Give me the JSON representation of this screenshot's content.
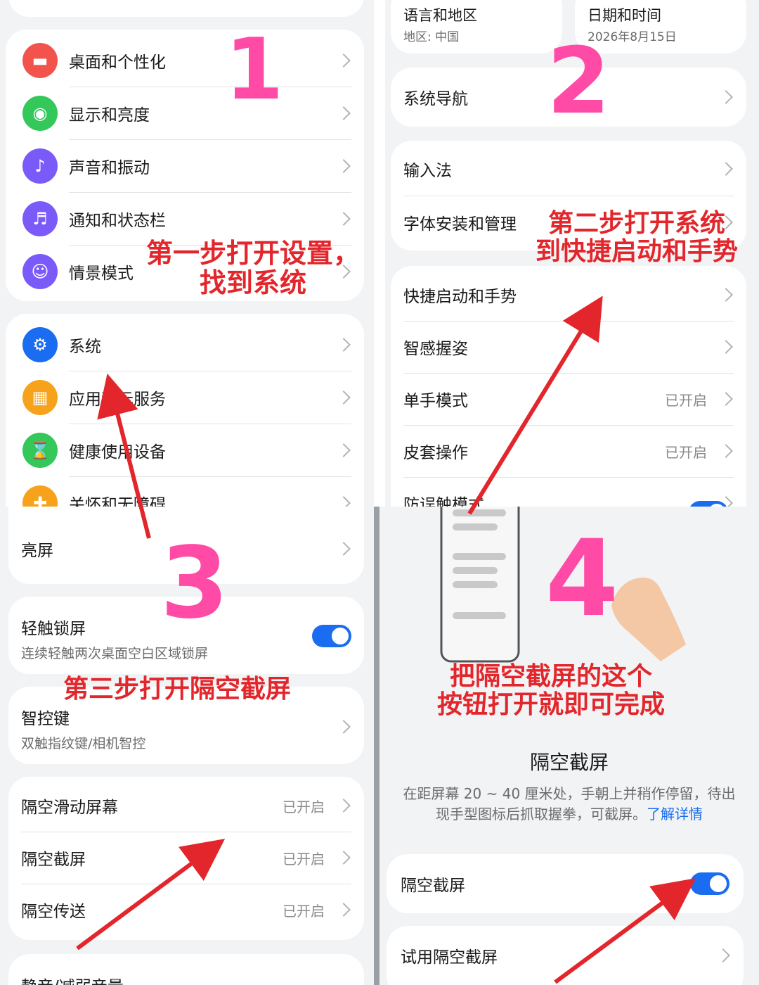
{
  "panel1": {
    "card_a_items": [
      {
        "label": "桌面和个性化",
        "icon": "paint-roller-icon",
        "icon_bg": "#f2544d"
      },
      {
        "label": "显示和亮度",
        "icon": "eye-icon",
        "icon_bg": "#34c759"
      },
      {
        "label": "声音和振动",
        "icon": "speaker-icon",
        "icon_bg": "#7a5af8"
      },
      {
        "label": "通知和状态栏",
        "icon": "bell-icon",
        "icon_bg": "#7a5af8"
      },
      {
        "label": "情景模式",
        "icon": "person-circle-icon",
        "icon_bg": "#7a5af8"
      }
    ],
    "card_b_items": [
      {
        "label": "系统",
        "icon": "gear-icon",
        "icon_bg": "#1a6cf0"
      },
      {
        "label": "应用和元服务",
        "icon": "apps-grid-icon",
        "icon_bg": "#f7a21b"
      },
      {
        "label": "健康使用设备",
        "icon": "hourglass-icon",
        "icon_bg": "#34c759"
      },
      {
        "label": "关怀和无障碍",
        "icon": "accessibility-icon",
        "icon_bg": "#f7a21b"
      }
    ],
    "annotation": "第一步打开设置，\n找到系统",
    "step_number": "1"
  },
  "panel2": {
    "tiles": [
      {
        "title": "语言和地区",
        "sub": "地区: 中国"
      },
      {
        "title": "日期和时间",
        "sub": "2026年8月15日"
      }
    ],
    "nav_label": "系统导航",
    "card_input_items": [
      {
        "label": "输入法"
      },
      {
        "label": "字体安装和管理"
      }
    ],
    "card_gesture_items": [
      {
        "label": "快捷启动和手势",
        "status": ""
      },
      {
        "label": "智感握姿",
        "status": ""
      },
      {
        "label": "单手模式",
        "status": "已开启"
      },
      {
        "label": "皮套操作",
        "status": "已开启"
      },
      {
        "label": "防误触模式",
        "status": ""
      }
    ],
    "annotation": "第二步打开系统\n到快捷启动和手势",
    "step_number": "2"
  },
  "panel3": {
    "top_label": "亮屏",
    "lock": {
      "title": "轻触锁屏",
      "sub": "连续轻触两次桌面空白区域锁屏"
    },
    "smart": {
      "title": "智控键",
      "sub": "双触指纹键/相机智控"
    },
    "air_items": [
      {
        "label": "隔空滑动屏幕",
        "status": "已开启"
      },
      {
        "label": "隔空截屏",
        "status": "已开启"
      },
      {
        "label": "隔空传送",
        "status": "已开启"
      }
    ],
    "bottom_label": "静音/减弱音量",
    "annotation": "第三步打开隔空截屏",
    "step_number": "3"
  },
  "panel4": {
    "title": "隔空截屏",
    "desc": "在距屏幕 20 ~ 40 厘米处，手朝上并稍作停留，待出现手型图标后抓取握拳，可截屏。",
    "link": "了解详情",
    "toggle_label": "隔空截屏",
    "try_label": "试用隔空截屏",
    "annotation": "把隔空截屏的这个\n按钮打开就即可完成",
    "step_number": "4"
  },
  "colors": {
    "accent": "#1a6cf0",
    "annotation_red": "#e3262b",
    "number_pink": "#ff4aa6"
  }
}
